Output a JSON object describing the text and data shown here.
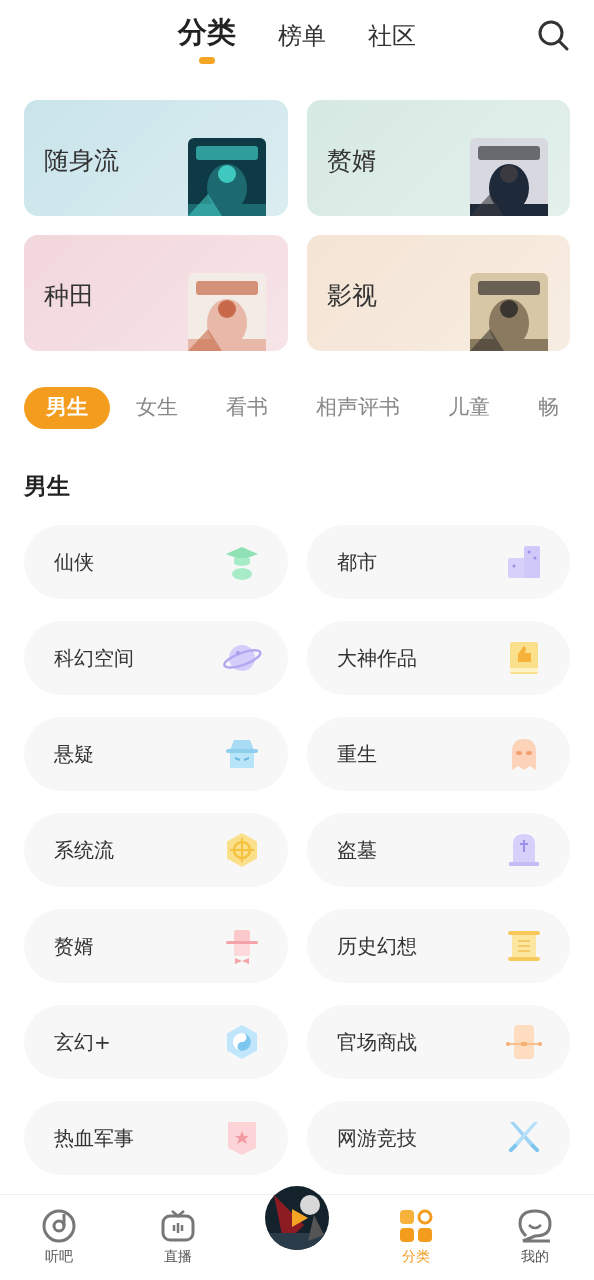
{
  "top_tabs": [
    {
      "label": "分类",
      "selected": true
    },
    {
      "label": "榜单",
      "selected": false
    },
    {
      "label": "社区",
      "selected": false
    }
  ],
  "featured": [
    {
      "title": "随身流",
      "color": "#c9e4ea"
    },
    {
      "title": "赘婿",
      "color": "#d6e9e2"
    },
    {
      "title": "种田",
      "color": "#f2d7dc"
    },
    {
      "title": "影视",
      "color": "#f4e4d4"
    }
  ],
  "filters": [
    {
      "label": "男生",
      "selected": true
    },
    {
      "label": "女生",
      "selected": false
    },
    {
      "label": "看书",
      "selected": false
    },
    {
      "label": "相声评书",
      "selected": false
    },
    {
      "label": "儿童",
      "selected": false
    },
    {
      "label": "畅",
      "selected": false
    }
  ],
  "section_title": "男生",
  "genres": [
    "仙侠",
    "都市",
    "科幻空间",
    "大神作品",
    "悬疑",
    "重生",
    "系统流",
    "盗墓",
    "赘婿",
    "历史幻想",
    "玄幻+",
    "官场商战",
    "热血军事",
    "网游竞技"
  ],
  "bottom_nav": [
    {
      "label": "听吧",
      "selected": false
    },
    {
      "label": "直播",
      "selected": false
    },
    {
      "kind": "player"
    },
    {
      "label": "分类",
      "selected": true
    },
    {
      "label": "我的",
      "selected": false
    }
  ]
}
